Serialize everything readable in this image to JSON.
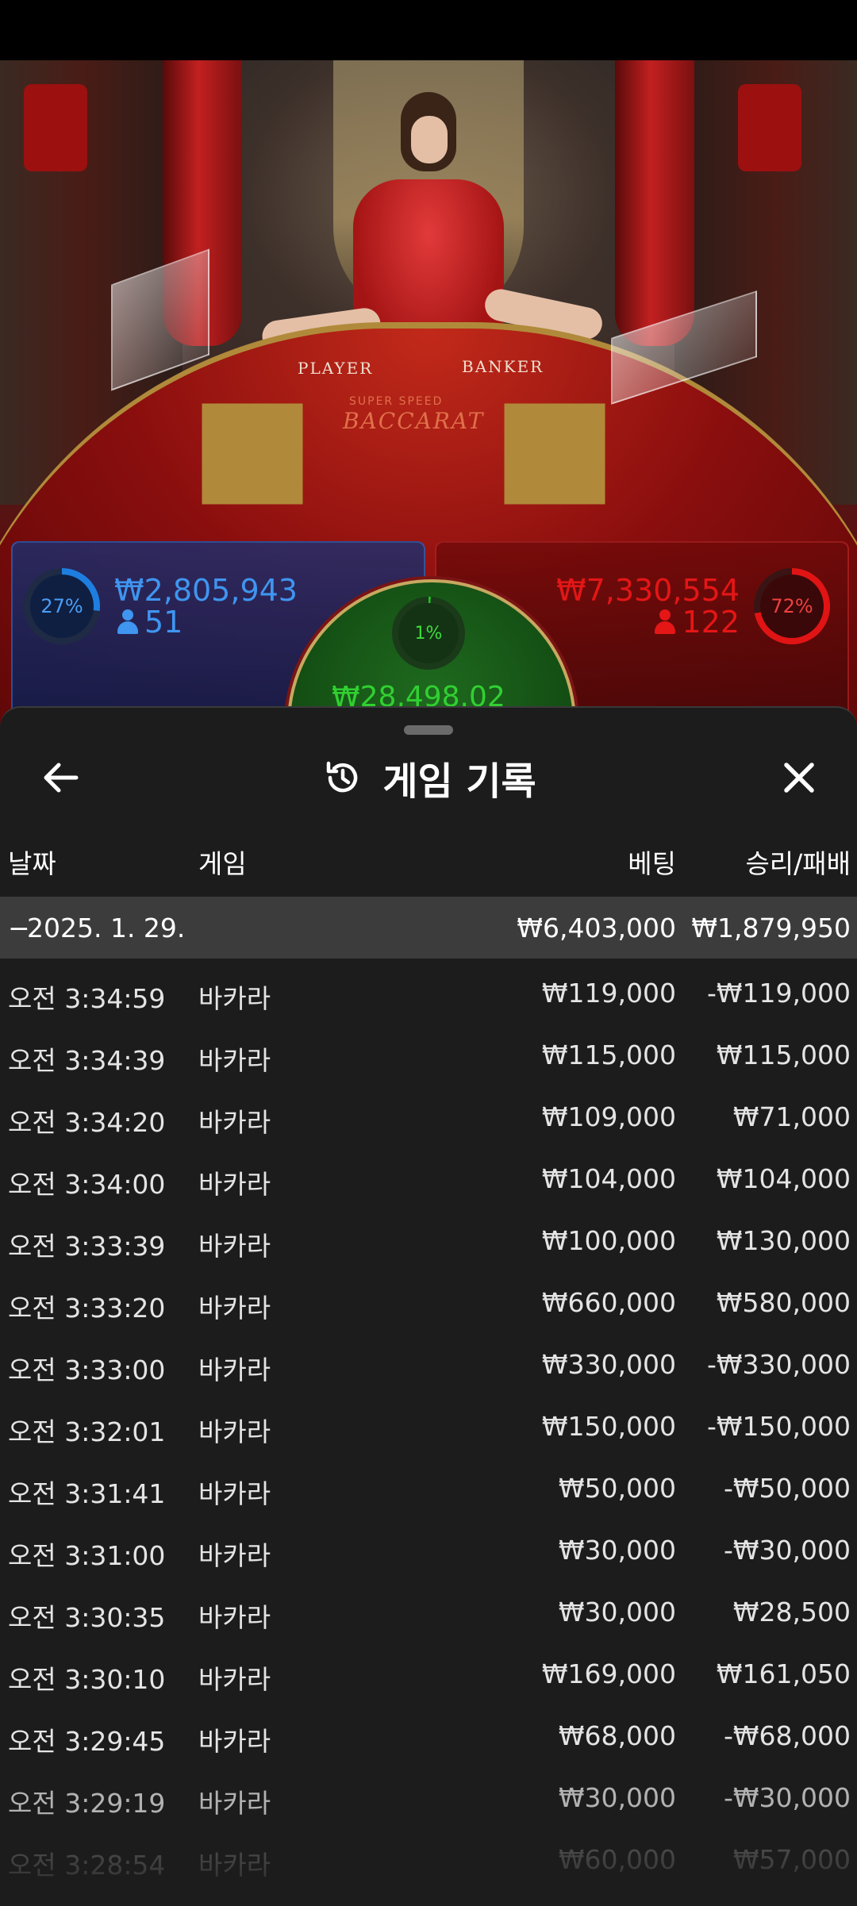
{
  "video": {
    "table_player_label": "PLAYER",
    "table_banker_label": "BANKER",
    "table_brand_small": "SUPER SPEED",
    "table_brand_big": "BACCARAT"
  },
  "bets": {
    "player": {
      "percent": "27%",
      "amount": "₩2,805,943",
      "players": "51",
      "color": "#3f95f0"
    },
    "banker": {
      "percent": "72%",
      "amount": "₩7,330,554",
      "players": "122",
      "color": "#e41616"
    },
    "tie": {
      "percent": "1%",
      "amount": "₩28,498.02",
      "color": "#31d031"
    }
  },
  "sheet": {
    "title": "게임 기록",
    "icons": {
      "back": "arrow-left-icon",
      "history": "history-icon",
      "close": "close-icon"
    },
    "columns": {
      "date": "날짜",
      "game": "게임",
      "bet": "베팅",
      "win_loss": "승리/패배"
    },
    "group": {
      "toggle": "−",
      "date": "2025. 1. 29.",
      "bet_total": "₩6,403,000",
      "win_loss_total": "₩1,879,950"
    },
    "rows": [
      {
        "time": "오전 3:34:59",
        "game": "바카라",
        "bet": "₩119,000",
        "win_loss": "-₩119,000"
      },
      {
        "time": "오전 3:34:39",
        "game": "바카라",
        "bet": "₩115,000",
        "win_loss": "₩115,000"
      },
      {
        "time": "오전 3:34:20",
        "game": "바카라",
        "bet": "₩109,000",
        "win_loss": "₩71,000"
      },
      {
        "time": "오전 3:34:00",
        "game": "바카라",
        "bet": "₩104,000",
        "win_loss": "₩104,000"
      },
      {
        "time": "오전 3:33:39",
        "game": "바카라",
        "bet": "₩100,000",
        "win_loss": "₩130,000"
      },
      {
        "time": "오전 3:33:20",
        "game": "바카라",
        "bet": "₩660,000",
        "win_loss": "₩580,000"
      },
      {
        "time": "오전 3:33:00",
        "game": "바카라",
        "bet": "₩330,000",
        "win_loss": "-₩330,000"
      },
      {
        "time": "오전 3:32:01",
        "game": "바카라",
        "bet": "₩150,000",
        "win_loss": "-₩150,000"
      },
      {
        "time": "오전 3:31:41",
        "game": "바카라",
        "bet": "₩50,000",
        "win_loss": "-₩50,000"
      },
      {
        "time": "오전 3:31:00",
        "game": "바카라",
        "bet": "₩30,000",
        "win_loss": "-₩30,000"
      },
      {
        "time": "오전 3:30:35",
        "game": "바카라",
        "bet": "₩30,000",
        "win_loss": "₩28,500"
      },
      {
        "time": "오전 3:30:10",
        "game": "바카라",
        "bet": "₩169,000",
        "win_loss": "₩161,050"
      },
      {
        "time": "오전 3:29:45",
        "game": "바카라",
        "bet": "₩68,000",
        "win_loss": "-₩68,000"
      },
      {
        "time": "오전 3:29:19",
        "game": "바카라",
        "bet": "₩30,000",
        "win_loss": "-₩30,000"
      },
      {
        "time": "오전 3:28:54",
        "game": "바카라",
        "bet": "₩60,000",
        "win_loss": "₩57,000"
      }
    ]
  }
}
